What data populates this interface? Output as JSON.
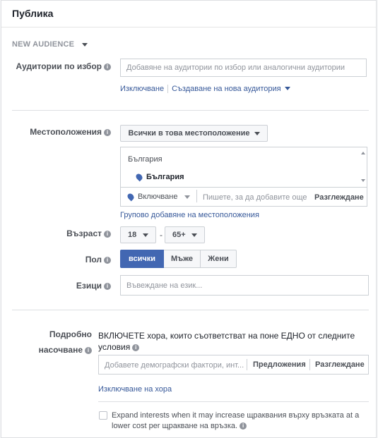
{
  "panel": {
    "title": "Публика"
  },
  "new_audience": {
    "label": "NEW AUDIENCE"
  },
  "custom_audiences": {
    "label": "Аудитории по избор",
    "placeholder": "Добавяне на аудитории по избор или аналогични аудитории",
    "exclude_link": "Изключване",
    "create_link": "Създаване на нова аудитория"
  },
  "locations": {
    "label": "Местоположения",
    "dropdown": "Всички в това местоположение",
    "list_header": "България",
    "selected": "България",
    "include_dropdown": "Включване",
    "search_placeholder": "Пишете, за да добавите още местоположения",
    "browse": "Разглеждане",
    "bulk_link": "Групово добавяне на местоположения"
  },
  "age": {
    "label": "Възраст",
    "min": "18",
    "dash": "-",
    "max": "65+"
  },
  "gender": {
    "label": "Пол",
    "options": [
      "всички",
      "Мъже",
      "Жени"
    ],
    "selected": "всички"
  },
  "languages": {
    "label": "Езици",
    "placeholder": "Въвеждане на език..."
  },
  "detailed": {
    "label_line1": "Подробно",
    "label_line2": "насочване",
    "description": "ВКЛЮЧЕТЕ хора, които съответстват на поне ЕДНО от следните условия",
    "placeholder": "Добавете демографски фактори, инт...",
    "suggestions": "Предложения",
    "browse": "Разглеждане",
    "exclude_link": "Изключване на хора",
    "expand_text_1": "Expand interests when it may increase щраквания върху връзката at a",
    "expand_text_2": "lower cost per щракване на връзка."
  },
  "icons": [
    "info-icon",
    "caret-down-icon",
    "location-pin-icon",
    "scroll-up-icon",
    "scroll-down-icon",
    "checkbox-icon"
  ],
  "colors": {
    "accent": "#4267b2",
    "link": "#365899",
    "text": "#1d2129",
    "muted": "#90949c"
  }
}
